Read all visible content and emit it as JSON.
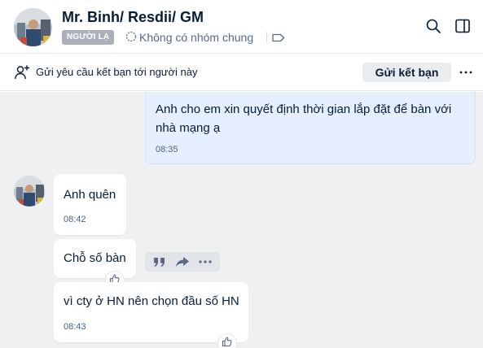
{
  "header": {
    "contact_name": "Mr. Binh/ Resdii/ GM",
    "badge": "NGƯỜI LẠ",
    "group_info": "Không có nhóm chung",
    "icons": [
      "tag-icon",
      "search-icon",
      "sidebar-toggle-icon"
    ]
  },
  "friend_request": {
    "text": "Gửi yêu cầu kết bạn tới người này",
    "button_label": "Gửi kết bạn",
    "more_icon": "more-icon"
  },
  "messages": [
    {
      "direction": "outgoing",
      "text": "Anh cho em xin quyết định thời gian lắp đặt để bàn với nhà mạng ạ",
      "time": "08:35"
    },
    {
      "direction": "incoming",
      "text": "Anh quên",
      "time": "08:42"
    },
    {
      "direction": "incoming",
      "text": "Chỗ số bàn",
      "time": ""
    },
    {
      "direction": "incoming",
      "text": "vì cty ở HN nên chọn đầu số HN",
      "time": "08:43"
    }
  ],
  "message_actions": [
    "quote-icon",
    "forward-icon",
    "more-icon"
  ],
  "colors": {
    "outgoing_bubble": "#e5efff",
    "incoming_bubble": "#ffffff",
    "chat_background": "#eef0f1",
    "badge_background": "#a9b0ba"
  }
}
